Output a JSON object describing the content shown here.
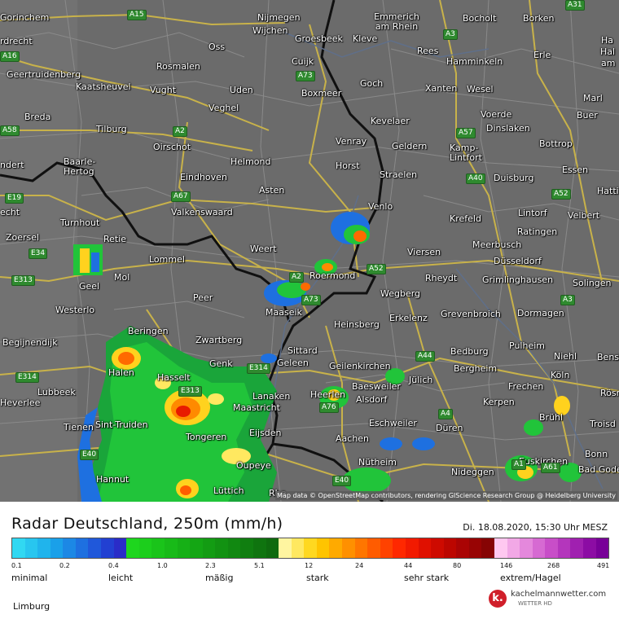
{
  "map": {
    "cities": [
      {
        "name": "Gorinchem"
      },
      {
        "name": "Nijmegen"
      },
      {
        "name": "Emmerich am Rhein"
      },
      {
        "name": "Bocholt"
      },
      {
        "name": "Borken"
      },
      {
        "name": "Wijchen"
      },
      {
        "name": "Groesbeek"
      },
      {
        "name": "Kleve"
      },
      {
        "name": "Oss"
      },
      {
        "name": "Rees"
      },
      {
        "name": "Hamminkeln"
      },
      {
        "name": "Erle"
      },
      {
        "name": "Geertruidenberg"
      },
      {
        "name": "Rosmalen"
      },
      {
        "name": "Cuijk"
      },
      {
        "name": "Kaatsheuvel"
      },
      {
        "name": "Vught"
      },
      {
        "name": "Uden"
      },
      {
        "name": "Goch"
      },
      {
        "name": "Xanten"
      },
      {
        "name": "Wesel"
      },
      {
        "name": "Marl"
      },
      {
        "name": "Boxmeer"
      },
      {
        "name": "Veghel"
      },
      {
        "name": "Voerde"
      },
      {
        "name": "Buer"
      },
      {
        "name": "Breda"
      },
      {
        "name": "Kevelaer"
      },
      {
        "name": "Tilburg"
      },
      {
        "name": "Dinslaken"
      },
      {
        "name": "Venray"
      },
      {
        "name": "Oirschot"
      },
      {
        "name": "Geldern"
      },
      {
        "name": "Kamp-Lintfort"
      },
      {
        "name": "Bottrop"
      },
      {
        "name": "Essen"
      },
      {
        "name": "Baarle-Hertog"
      },
      {
        "name": "Helmond"
      },
      {
        "name": "Horst"
      },
      {
        "name": "Straelen"
      },
      {
        "name": "Duisburg"
      },
      {
        "name": "Eindhoven"
      },
      {
        "name": "Asten"
      },
      {
        "name": "Hatti"
      },
      {
        "name": "Venlo"
      },
      {
        "name": "Valkenswaard"
      },
      {
        "name": "Krefeld"
      },
      {
        "name": "Lintorf"
      },
      {
        "name": "Velbert"
      },
      {
        "name": "Turnhout"
      },
      {
        "name": "Ratingen"
      },
      {
        "name": "Zoersel"
      },
      {
        "name": "Retie"
      },
      {
        "name": "Meerbusch"
      },
      {
        "name": "Weert"
      },
      {
        "name": "Viersen"
      },
      {
        "name": "Düsseldorf"
      },
      {
        "name": "Lommel"
      },
      {
        "name": "Roermond"
      },
      {
        "name": "Rheydt"
      },
      {
        "name": "Grimlinghausen"
      },
      {
        "name": "Solingen"
      },
      {
        "name": "Mol"
      },
      {
        "name": "Geel"
      },
      {
        "name": "Wegberg"
      },
      {
        "name": "Peer"
      },
      {
        "name": "Westerlo"
      },
      {
        "name": "Maaseik"
      },
      {
        "name": "Erkelenz"
      },
      {
        "name": "Grevenbroich"
      },
      {
        "name": "Dormagen"
      },
      {
        "name": "Heinsberg"
      },
      {
        "name": "Beringen"
      },
      {
        "name": "Begijnendijk"
      },
      {
        "name": "Zwartberg"
      },
      {
        "name": "Pulheim"
      },
      {
        "name": "Sittard"
      },
      {
        "name": "Bedburg"
      },
      {
        "name": "Geleen"
      },
      {
        "name": "Geilenkirchen"
      },
      {
        "name": "Genk"
      },
      {
        "name": "Niehl"
      },
      {
        "name": "Bensb"
      },
      {
        "name": "Halen"
      },
      {
        "name": "Hasselt"
      },
      {
        "name": "Bergheim"
      },
      {
        "name": "Jülich"
      },
      {
        "name": "Baesweiler"
      },
      {
        "name": "Frechen"
      },
      {
        "name": "Köln"
      },
      {
        "name": "Lubbeek"
      },
      {
        "name": "Heerlen"
      },
      {
        "name": "Lanaken"
      },
      {
        "name": "Alsdorf"
      },
      {
        "name": "Kerpen"
      },
      {
        "name": "Rösr"
      },
      {
        "name": "Heverlee"
      },
      {
        "name": "Maastricht"
      },
      {
        "name": "Brühl"
      },
      {
        "name": "Sint-Truiden"
      },
      {
        "name": "Eschweiler"
      },
      {
        "name": "Düren"
      },
      {
        "name": "Tienen"
      },
      {
        "name": "Eijsden"
      },
      {
        "name": "Troisd"
      },
      {
        "name": "Tongeren"
      },
      {
        "name": "Aachen"
      },
      {
        "name": "Bonn"
      },
      {
        "name": "Nütheim"
      },
      {
        "name": "Oupeye"
      },
      {
        "name": "Euskirchen"
      },
      {
        "name": "Nideggen"
      },
      {
        "name": "Bad Godes"
      },
      {
        "name": "Hannut"
      },
      {
        "name": "Lüttich"
      },
      {
        "name": "Rhe"
      },
      {
        "name": "Hal"
      },
      {
        "name": "am"
      },
      {
        "name": "rdrecht"
      },
      {
        "name": "ndert"
      },
      {
        "name": "echt"
      },
      {
        "name": "Ha"
      }
    ],
    "roads": [
      {
        "label": "A15"
      },
      {
        "label": "A31"
      },
      {
        "label": "A16"
      },
      {
        "label": "A3"
      },
      {
        "label": "A73"
      },
      {
        "label": "A58"
      },
      {
        "label": "A2"
      },
      {
        "label": "A57"
      },
      {
        "label": "A40"
      },
      {
        "label": "E19"
      },
      {
        "label": "A67"
      },
      {
        "label": "A52"
      },
      {
        "label": "E34"
      },
      {
        "label": "E313"
      },
      {
        "label": "A52"
      },
      {
        "label": "A2"
      },
      {
        "label": "A73"
      },
      {
        "label": "A3"
      },
      {
        "label": "E314"
      },
      {
        "label": "E314"
      },
      {
        "label": "A44"
      },
      {
        "label": "E313"
      },
      {
        "label": "A76"
      },
      {
        "label": "A4"
      },
      {
        "label": "E40"
      },
      {
        "label": "E40"
      },
      {
        "label": "A1"
      },
      {
        "label": "A61"
      }
    ],
    "attribution": "Map data © OpenStreetMap contributors, rendering GIScience Research Group @ Heidelberg University"
  },
  "legend": {
    "title": "Radar Deutschland, 250m (mm/h)",
    "datetime": "Di. 18.08.2020, 15:30 Uhr MESZ",
    "colors": [
      "#31d8f2",
      "#28c6ef",
      "#20b4ec",
      "#1aa0e9",
      "#1c88e5",
      "#1e70e0",
      "#2058da",
      "#2240d2",
      "#2a2cc8",
      "#1ed61e",
      "#1cce1c",
      "#1ac41a",
      "#18ba18",
      "#16b016",
      "#14a614",
      "#139c13",
      "#129212",
      "#118811",
      "#107e10",
      "#0f740f",
      "#0e6a0e",
      "#fff5a0",
      "#ffe860",
      "#ffd820",
      "#ffc400",
      "#ffaa00",
      "#ff9000",
      "#ff7600",
      "#ff5c00",
      "#ff4200",
      "#ff2800",
      "#f21a00",
      "#e01000",
      "#ce0a00",
      "#bc0600",
      "#aa0404",
      "#980404",
      "#860404",
      "#ffc8f0",
      "#f2a8e6",
      "#e488dc",
      "#d66ad2",
      "#c84ec8",
      "#b436bc",
      "#a020b0",
      "#8c0ca4",
      "#780098"
    ],
    "ticks": [
      "0.1",
      "0.2",
      "0.4",
      "1.0",
      "2.3",
      "5.1",
      "12",
      "24",
      "44",
      "80",
      "146",
      "268",
      "491"
    ],
    "categories": [
      "minimal",
      "leicht",
      "mäßig",
      "stark",
      "sehr stark",
      "extrem/Hagel"
    ],
    "region": "Limburg"
  },
  "brand": {
    "name": "kachelmannwetter.com",
    "sub": "WETTER HD",
    "icon": "kachelmann-logo-icon",
    "letter": "k."
  }
}
